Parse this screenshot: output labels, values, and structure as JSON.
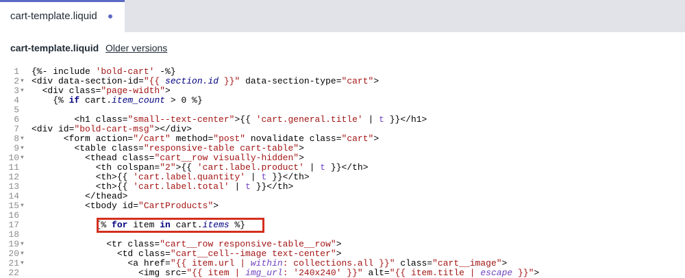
{
  "tab": {
    "label": "cart-template.liquid",
    "unsaved_dot": "●"
  },
  "header": {
    "filename": "cart-template.liquid",
    "older_versions": "Older versions"
  },
  "colors": {
    "tag": "#000080",
    "attr": "#000000",
    "string": "#a31515",
    "keyword": "#000080",
    "variable": "#000080",
    "filter": "#6f42c1",
    "plain": "#000000",
    "highlight_box": "#d32f1e",
    "tab_accent": "#5c6ac4"
  },
  "code_lines": [
    {
      "num": "1",
      "fold": false,
      "tokens": [
        [
          "p",
          "{%- include "
        ],
        [
          "s",
          "'bold-cart'"
        ],
        [
          "p",
          " -%}"
        ]
      ]
    },
    {
      "num": "2",
      "fold": true,
      "tokens": [
        [
          "p",
          "<div data-section-id="
        ],
        [
          "s",
          "\"{{ "
        ],
        [
          "vi",
          "section.id"
        ],
        [
          "s",
          " }}\""
        ],
        [
          "p",
          " data-section-type="
        ],
        [
          "s",
          "\"cart\""
        ],
        [
          "p",
          ">"
        ]
      ]
    },
    {
      "num": "3",
      "fold": true,
      "tokens": [
        [
          "p",
          "  <div class="
        ],
        [
          "s",
          "\"page-width\""
        ],
        [
          "p",
          ">"
        ]
      ]
    },
    {
      "num": "4",
      "fold": false,
      "tokens": [
        [
          "p",
          "    {% "
        ],
        [
          "k",
          "if"
        ],
        [
          "p",
          " cart."
        ],
        [
          "vi",
          "item_count"
        ],
        [
          "p",
          " > 0 %}"
        ]
      ]
    },
    {
      "num": "5",
      "fold": false,
      "tokens": []
    },
    {
      "num": "6",
      "fold": false,
      "tokens": [
        [
          "p",
          "        <h1 class="
        ],
        [
          "s",
          "\"small--text-center\""
        ],
        [
          "p",
          ">{{ "
        ],
        [
          "s",
          "'cart.general.title'"
        ],
        [
          "p",
          " | "
        ],
        [
          "f",
          "t"
        ],
        [
          "p",
          " }}</h1>"
        ]
      ]
    },
    {
      "num": "7",
      "fold": false,
      "tokens": [
        [
          "p",
          "<div id="
        ],
        [
          "s",
          "\"bold-cart-msg\""
        ],
        [
          "p",
          "></div>"
        ]
      ]
    },
    {
      "num": "8",
      "fold": true,
      "tokens": [
        [
          "p",
          "      <form action="
        ],
        [
          "s",
          "\"/cart\""
        ],
        [
          "p",
          " method="
        ],
        [
          "s",
          "\"post\""
        ],
        [
          "p",
          " novalidate class="
        ],
        [
          "s",
          "\"cart\""
        ],
        [
          "p",
          ">"
        ]
      ]
    },
    {
      "num": "9",
      "fold": true,
      "tokens": [
        [
          "p",
          "        <table class="
        ],
        [
          "s",
          "\"responsive-table cart-table\""
        ],
        [
          "p",
          ">"
        ]
      ]
    },
    {
      "num": "10",
      "fold": true,
      "tokens": [
        [
          "p",
          "          <thead class="
        ],
        [
          "s",
          "\"cart__row visually-hidden\""
        ],
        [
          "p",
          ">"
        ]
      ]
    },
    {
      "num": "11",
      "fold": false,
      "tokens": [
        [
          "p",
          "            <th colspan="
        ],
        [
          "s",
          "\"2\""
        ],
        [
          "p",
          ">{{ "
        ],
        [
          "s",
          "'cart.label.product'"
        ],
        [
          "p",
          " | "
        ],
        [
          "f",
          "t"
        ],
        [
          "p",
          " }}</th>"
        ]
      ]
    },
    {
      "num": "12",
      "fold": false,
      "tokens": [
        [
          "p",
          "            <th>{{ "
        ],
        [
          "s",
          "'cart.label.quantity'"
        ],
        [
          "p",
          " | "
        ],
        [
          "f",
          "t"
        ],
        [
          "p",
          " }}</th>"
        ]
      ]
    },
    {
      "num": "13",
      "fold": false,
      "tokens": [
        [
          "p",
          "            <th>{{ "
        ],
        [
          "s",
          "'cart.label.total'"
        ],
        [
          "p",
          " | "
        ],
        [
          "f",
          "t"
        ],
        [
          "p",
          " }}</th>"
        ]
      ]
    },
    {
      "num": "14",
      "fold": false,
      "tokens": [
        [
          "p",
          "          </thead>"
        ]
      ]
    },
    {
      "num": "15",
      "fold": true,
      "tokens": [
        [
          "p",
          "          <tbody id="
        ],
        [
          "s",
          "\"CartProducts\""
        ],
        [
          "p",
          ">"
        ]
      ]
    },
    {
      "num": "16",
      "fold": false,
      "tokens": []
    },
    {
      "num": "17",
      "fold": false,
      "tokens": [
        [
          "p",
          "            {% "
        ],
        [
          "k",
          "for"
        ],
        [
          "p",
          " item "
        ],
        [
          "k",
          "in"
        ],
        [
          "p",
          " cart."
        ],
        [
          "vi",
          "items"
        ],
        [
          "p",
          " %}"
        ]
      ]
    },
    {
      "num": "18",
      "fold": false,
      "tokens": []
    },
    {
      "num": "19",
      "fold": true,
      "tokens": [
        [
          "p",
          "              <tr class="
        ],
        [
          "s",
          "\"cart__row responsive-table__row\""
        ],
        [
          "p",
          ">"
        ]
      ]
    },
    {
      "num": "20",
      "fold": true,
      "tokens": [
        [
          "p",
          "                <td class="
        ],
        [
          "s",
          "\"cart__cell--image text-center\""
        ],
        [
          "p",
          ">"
        ]
      ]
    },
    {
      "num": "21",
      "fold": true,
      "tokens": [
        [
          "p",
          "                  <a href="
        ],
        [
          "s",
          "\"{{ item.url | "
        ],
        [
          "fi",
          "within"
        ],
        [
          "s",
          ": collections.all }}\""
        ],
        [
          "p",
          " class="
        ],
        [
          "s",
          "\"cart__image\""
        ],
        [
          "p",
          ">"
        ]
      ]
    },
    {
      "num": "22",
      "fold": false,
      "tokens": [
        [
          "p",
          "                    <img src="
        ],
        [
          "s",
          "\"{{ item | "
        ],
        [
          "fi",
          "img_url"
        ],
        [
          "s",
          ": '240x240' }}\""
        ],
        [
          "p",
          " alt="
        ],
        [
          "s",
          "\"{{ item.title | "
        ],
        [
          "fi",
          "escape"
        ],
        [
          "s",
          " }}\""
        ],
        [
          "p",
          ">"
        ]
      ]
    }
  ]
}
